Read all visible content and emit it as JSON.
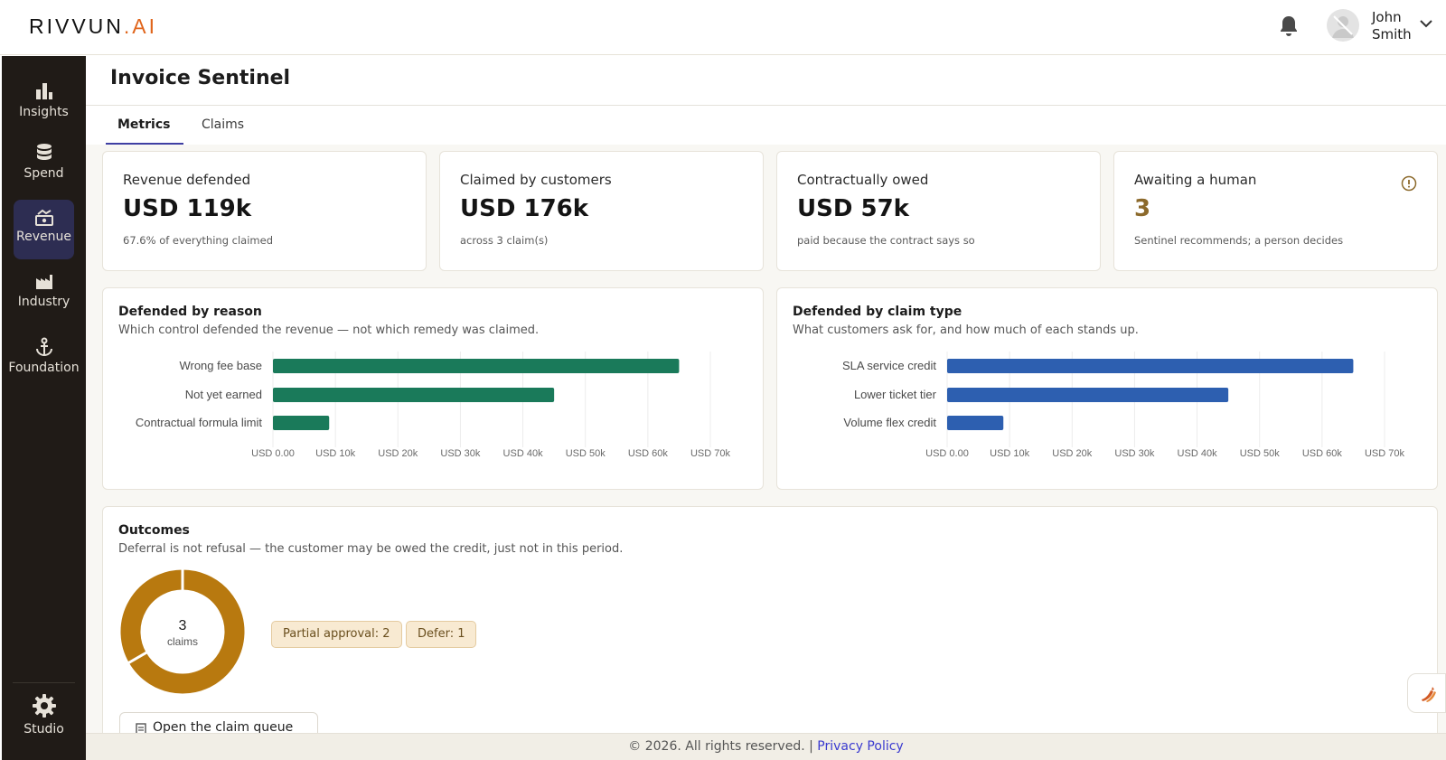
{
  "header": {
    "logo_main": "RIVVUN",
    "logo_suffix": ".AI",
    "user_first": "John",
    "user_last": "Smith",
    "icons": [
      "bell-icon",
      "avatar-icon",
      "chevron-down-icon"
    ]
  },
  "sidebar": {
    "items": [
      {
        "label": "Insights",
        "icon": "bar-chart-icon",
        "active": false
      },
      {
        "label": "Spend",
        "icon": "database-icon",
        "active": false
      },
      {
        "label": "Revenue",
        "icon": "money-icon",
        "active": true
      },
      {
        "label": "Industry",
        "icon": "factory-icon",
        "active": false
      },
      {
        "label": "Foundation",
        "icon": "anchor-icon",
        "active": false
      }
    ],
    "studio_label": "Studio",
    "active_color": "#2d2d52"
  },
  "page": {
    "title": "Invoice Sentinel",
    "tabs": [
      {
        "label": "Metrics",
        "active": true
      },
      {
        "label": "Claims",
        "active": false
      }
    ]
  },
  "kpis": [
    {
      "label": "Revenue defended",
      "value": "USD 119k",
      "sub": "67.6% of everything claimed"
    },
    {
      "label": "Claimed by customers",
      "value": "USD 176k",
      "sub": "across 3 claim(s)"
    },
    {
      "label": "Contractually owed",
      "value": "USD 57k",
      "sub": "paid because the contract says so"
    },
    {
      "label": "Awaiting a human",
      "value": "3",
      "sub": "Sentinel recommends; a person decides"
    }
  ],
  "chart_data": [
    {
      "type": "bar",
      "orientation": "horizontal",
      "title": "Defended by reason",
      "subtitle": "Which control defended the revenue — not which remedy was claimed.",
      "categories": [
        "Wrong fee base",
        "Not yet earned",
        "Contractual formula limit"
      ],
      "values": [
        65000,
        45000,
        9000
      ],
      "xlim": [
        0,
        70000
      ],
      "ticks": [
        "USD 0.00",
        "USD 10k",
        "USD 20k",
        "USD 30k",
        "USD 40k",
        "USD 50k",
        "USD 60k",
        "USD 70k"
      ],
      "color": "#1a7a5a",
      "grid": true
    },
    {
      "type": "bar",
      "orientation": "horizontal",
      "title": "Defended by claim type",
      "subtitle": "What customers ask for, and how much of each stands up.",
      "categories": [
        "SLA service credit",
        "Lower ticket tier",
        "Volume flex credit"
      ],
      "values": [
        65000,
        45000,
        9000
      ],
      "xlim": [
        0,
        70000
      ],
      "ticks": [
        "USD 0.00",
        "USD 10k",
        "USD 20k",
        "USD 30k",
        "USD 40k",
        "USD 50k",
        "USD 60k",
        "USD 70k"
      ],
      "color": "#2d5fb0",
      "grid": true
    },
    {
      "type": "pie",
      "variant": "donut",
      "title": "Outcomes",
      "subtitle": "Deferral is not refusal — the customer may be owed the credit, just not in this period.",
      "center_value": "3",
      "center_label": "claims",
      "slices": [
        {
          "label": "Partial approval",
          "value": 2,
          "display": "Partial approval: 2"
        },
        {
          "label": "Defer",
          "value": 1,
          "display": "Defer: 1"
        }
      ],
      "color": "#b8790f"
    }
  ],
  "outcomes": {
    "queue_button": "Open the claim queue"
  },
  "footer": {
    "text": "© 2026. All rights reserved. |",
    "link": "Privacy Policy"
  }
}
